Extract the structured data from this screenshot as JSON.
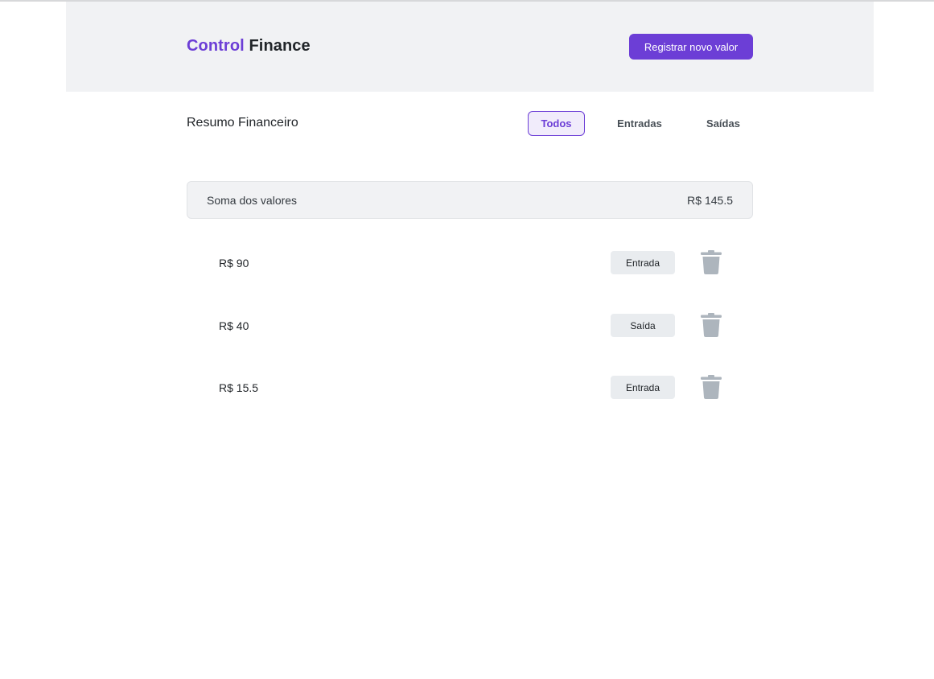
{
  "header": {
    "brand_primary": "Control",
    "brand_secondary": "Finance",
    "register_label": "Registrar novo valor"
  },
  "summary": {
    "title": "Resumo Financeiro",
    "filters": [
      {
        "label": "Todos",
        "active": true
      },
      {
        "label": "Entradas",
        "active": false
      },
      {
        "label": "Saídas",
        "active": false
      }
    ]
  },
  "totals": {
    "label": "Soma dos valores",
    "value": "R$ 145.5"
  },
  "entries": [
    {
      "amount": "R$ 90",
      "type": "Entrada",
      "icon": "trash-icon"
    },
    {
      "amount": "R$ 40",
      "type": "Saída",
      "icon": "trash-icon"
    },
    {
      "amount": "R$ 15.5",
      "type": "Entrada",
      "icon": "trash-icon"
    }
  ],
  "colors": {
    "brand": "#6c3ed6",
    "header_bg": "#f1f2f4",
    "trash_icon": "#adb5bd"
  }
}
